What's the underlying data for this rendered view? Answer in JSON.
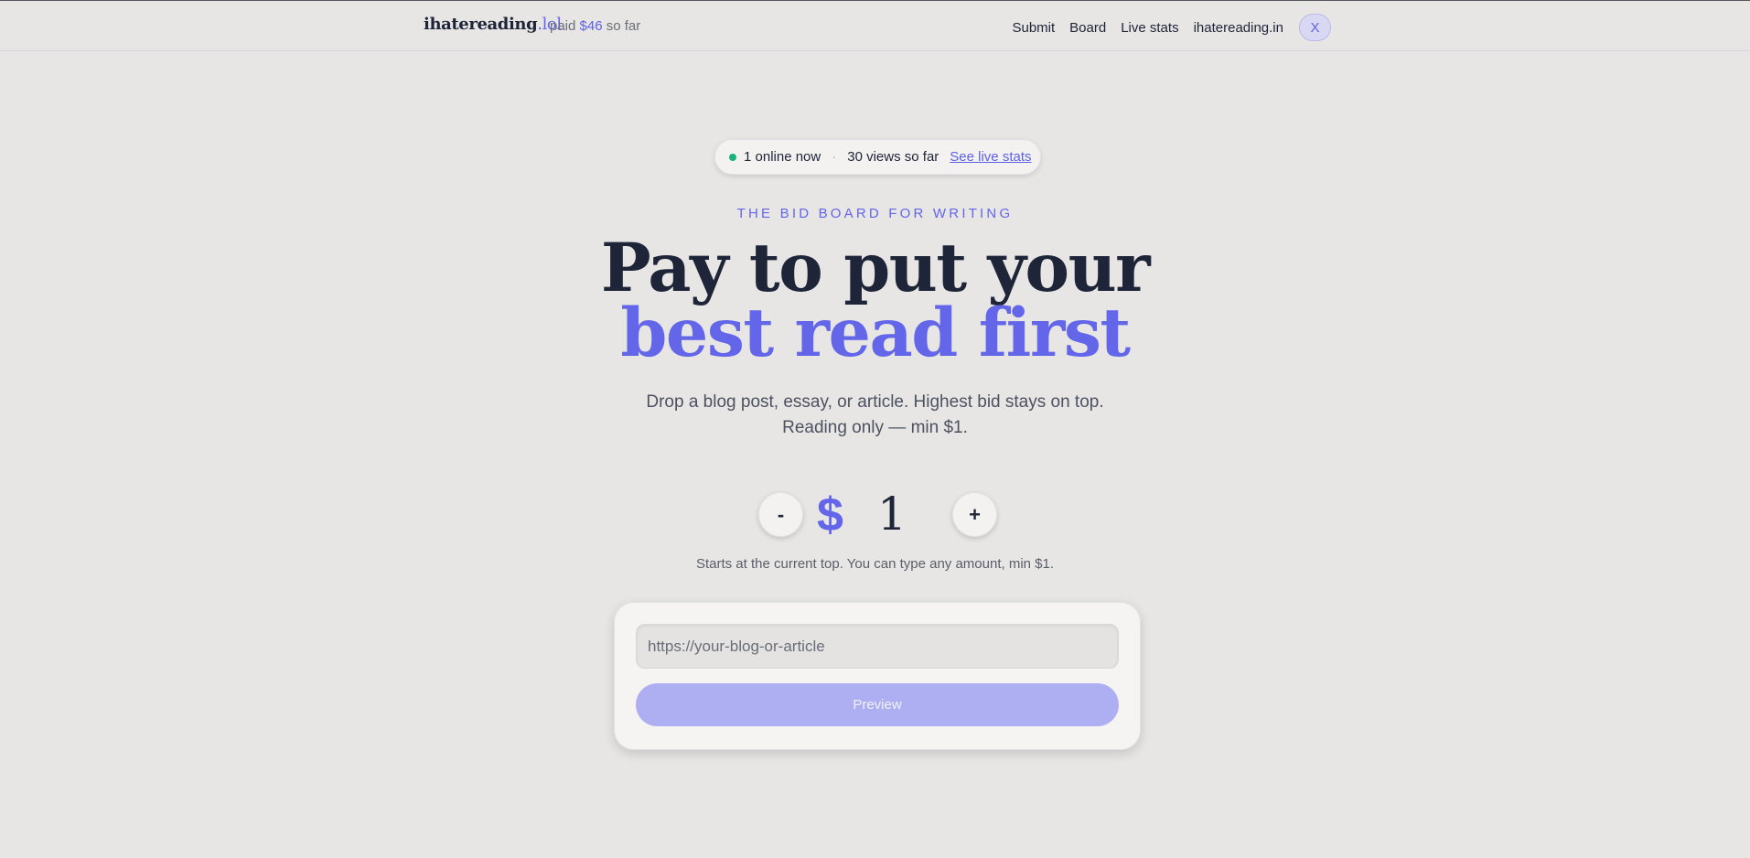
{
  "header": {
    "brand_name": "ihatereading",
    "brand_tld": ".lol",
    "paid_prefix": "paid",
    "paid_amount": "$46",
    "paid_suffix": "so far",
    "nav": [
      "Submit",
      "Board",
      "Live stats",
      "ihatereading.in"
    ],
    "x_label": "X"
  },
  "stats": {
    "online": "1 online now",
    "separator": "·",
    "views": "30 views so far",
    "live_link": "See live stats",
    "online_color": "#18b27a"
  },
  "hero": {
    "eyebrow": "THE BID BOARD FOR WRITING",
    "title_line1": "Pay to put your",
    "title_line2": "best read first",
    "subtitle_line1": "Drop a blog post, essay, or article. Highest bid stays on top.",
    "subtitle_line2": "Reading only — min $1."
  },
  "bid": {
    "minus_label": "-",
    "plus_label": "+",
    "currency": "$",
    "amount": "1",
    "hint": "Starts at the current top. You can type any amount, min $1."
  },
  "submit_form": {
    "url_placeholder": "https://your-blog-or-article",
    "url_value": "",
    "preview_label": "Preview"
  },
  "colors": {
    "accent": "#6366e8",
    "background": "#e7e6e5",
    "text": "#1e2538",
    "button_disabled": "#aeaff2"
  }
}
